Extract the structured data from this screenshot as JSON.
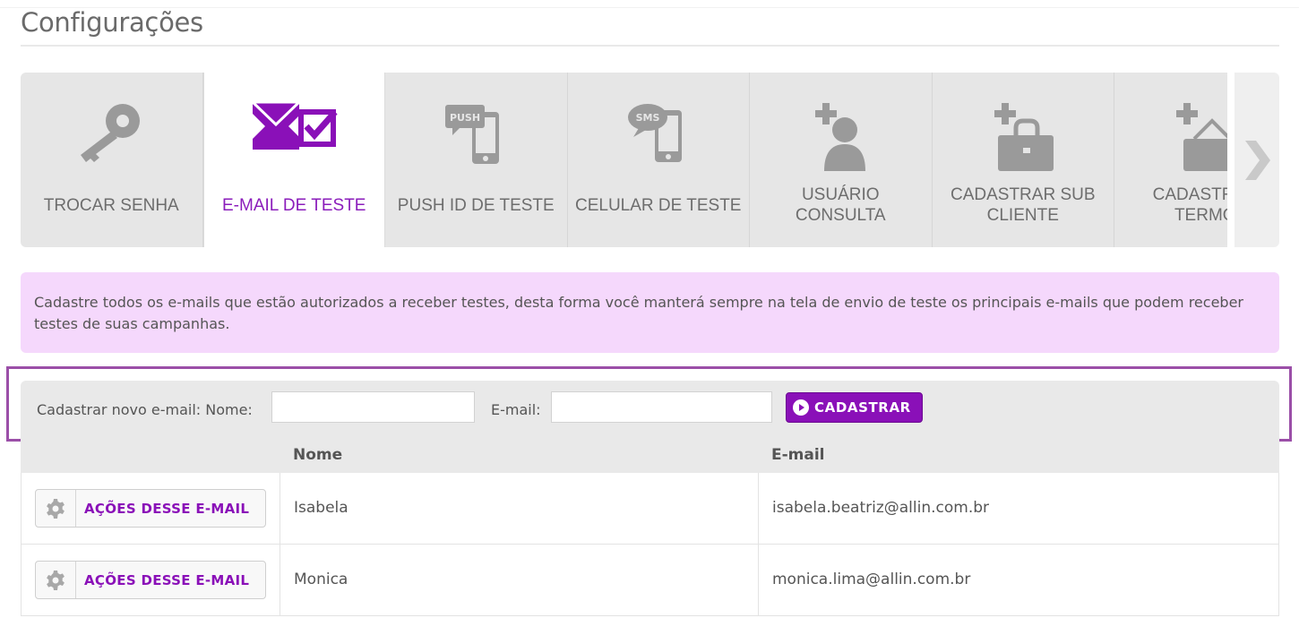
{
  "page": {
    "title": "Configurações"
  },
  "tabs": [
    {
      "label": "TROCAR SENHA",
      "icon": "key-icon",
      "active": false
    },
    {
      "label": "E-MAIL DE TESTE",
      "icon": "email-check-icon",
      "active": true
    },
    {
      "label": "PUSH ID DE TESTE",
      "icon": "push-phone-icon",
      "active": false
    },
    {
      "label": "CELULAR DE TESTE",
      "icon": "sms-phone-icon",
      "active": false
    },
    {
      "label": "USUÁRIO\nCONSULTA",
      "icon": "add-user-icon",
      "active": false
    },
    {
      "label": "CADASTRAR SUB\nCLIENTE",
      "icon": "add-bag-icon",
      "active": false
    },
    {
      "label": "CADASTRAR\nTERMO",
      "icon": "add-sign-icon",
      "active": false
    }
  ],
  "info": {
    "text": "Cadastre todos os e-mails que estão autorizados a receber testes, desta forma você manterá sempre na tela de envio de teste os principais e-mails que podem receber testes de suas campanhas."
  },
  "form": {
    "label_nome": "Cadastrar novo e-mail: Nome:",
    "nome_value": "",
    "label_email": "E-mail:",
    "email_value": "",
    "submit_label": "CADASTRAR"
  },
  "table": {
    "headers": {
      "nome": "Nome",
      "email": "E-mail"
    },
    "action_label": "AÇÕES DESSE E-MAIL",
    "rows": [
      {
        "nome": "Isabela",
        "email": "isabela.beatriz@allin.com.br"
      },
      {
        "nome": "Monica",
        "email": "monica.lima@allin.com.br"
      }
    ]
  },
  "colors": {
    "accent": "#8a10b8",
    "info_bg": "#f5d8fc",
    "icon_gray": "#9a9a9a"
  }
}
